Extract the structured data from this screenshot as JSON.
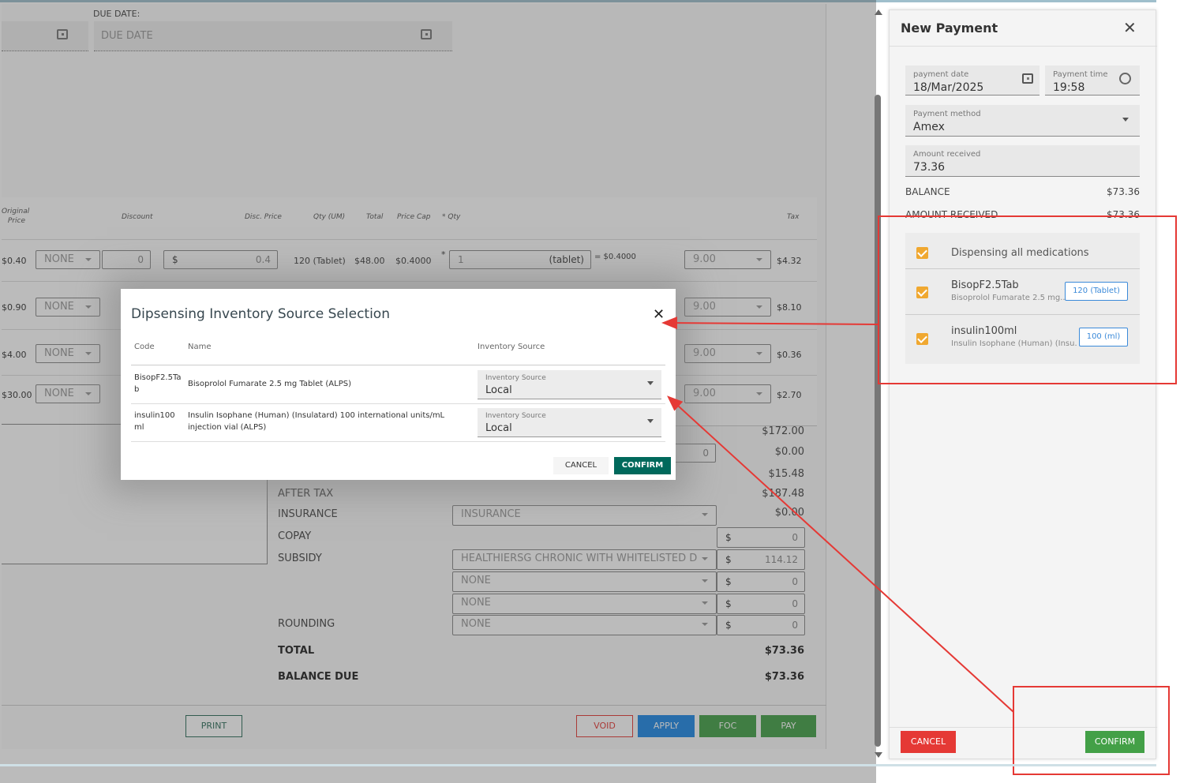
{
  "main": {
    "due_date_label": "DUE DATE:",
    "due_date_placeholder": "DUE DATE",
    "table_headers": {
      "original_price": "Original Price",
      "discount": "Discount",
      "disc_price": "Disc. Price",
      "qty_um": "Qty (UM)",
      "total": "Total",
      "price_cap": "Price Cap",
      "star_qty": "* Qty",
      "tax": "Tax"
    },
    "rows": [
      {
        "price": "$0.40",
        "discount_type": "NONE",
        "discount_value": "0",
        "currency": "$",
        "disc_price": "0.4",
        "qty_um": "120 (Tablet)",
        "total": "$48.00",
        "price_cap": "$0.4000",
        "qty_value": "1",
        "qty_unit": "(tablet)",
        "qty_eq": "= $0.4000",
        "tax_rate": "9.00",
        "tax": "$4.32"
      },
      {
        "price": "$0.90",
        "discount_type": "NONE",
        "tax_rate": "9.00",
        "tax": "$8.10"
      },
      {
        "price": "$4.00",
        "discount_type": "NONE",
        "tax_rate": "9.00",
        "tax": "$0.36"
      },
      {
        "price": "$30.00",
        "discount_type": "NONE",
        "tax_rate": "9.00",
        "tax": "$2.70"
      }
    ],
    "summary_values": {
      "v1": "$172.00",
      "discount_input": "0",
      "v2": "$0.00",
      "v3": "$15.48",
      "after_tax_label": "AFTER TAX",
      "after_tax": "$187.48",
      "insurance_label": "INSURANCE",
      "insurance_select": "INSURANCE",
      "insurance": "$0.00",
      "copay_label": "COPAY",
      "copay_currency": "$",
      "copay": "0",
      "subsidy_label": "SUBSIDY",
      "subsidy_select": "HEALTHIERSG CHRONIC WITH WHITELISTED D",
      "subsidy_currency": "$",
      "subsidy": "114.12",
      "extra1_select": "NONE",
      "extra1_currency": "$",
      "extra1": "0",
      "extra2_select": "NONE",
      "extra2_currency": "$",
      "extra2": "0",
      "rounding_label": "ROUNDING",
      "rounding_select": "NONE",
      "rounding_currency": "$",
      "rounding": "0",
      "total_label": "TOTAL",
      "total": "$73.36",
      "balance_due_label": "BALANCE DUE",
      "balance_due": "$73.36"
    },
    "buttons": {
      "print": "PRINT",
      "void": "VOID",
      "apply": "APPLY",
      "foc": "FOC",
      "pay": "PAY"
    }
  },
  "payment_panel": {
    "title": "New Payment",
    "payment_date_label": "payment date",
    "payment_date": "18/Mar/2025",
    "payment_time_label": "Payment time",
    "payment_time": "19:58",
    "payment_method_label": "Payment method",
    "payment_method": "Amex",
    "amount_received_label": "Amount received",
    "amount_received": "73.36",
    "balance_label": "BALANCE",
    "balance": "$73.36",
    "amount_received_row_label": "AMOUNT RECEIVED",
    "amount_received_row": "$73.36",
    "dispensing_all": "Dispensing all medications",
    "medications": [
      {
        "code": "BisopF2.5Tab",
        "name": "Bisoprolol Fumarate 2.5 mg...",
        "qty": "120 (Tablet)"
      },
      {
        "code": "insulin100ml",
        "name": "Insulin Isophane (Human) (Insu...",
        "qty": "100 (ml)"
      }
    ],
    "cancel": "CANCEL",
    "confirm": "CONFIRM"
  },
  "dialog": {
    "title": "Dipsensing Inventory Source Selection",
    "col_code": "Code",
    "col_name": "Name",
    "col_source": "Inventory Source",
    "rows": [
      {
        "code": "BisopF2.5Tab",
        "name": "Bisoprolol Fumarate 2.5 mg Tablet (ALPS)",
        "source_label": "Inventory Source",
        "source": "Local"
      },
      {
        "code": "insulin100ml",
        "name": "Insulin Isophane (Human) (Insulatard) 100 international units/mL injection vial (ALPS)",
        "source_label": "Inventory Source",
        "source": "Local"
      }
    ],
    "cancel": "CANCEL",
    "confirm": "CONFIRM"
  },
  "colors": {
    "confirm_green": "#00695c",
    "pay_green": "#43a047",
    "apply_blue": "#1e88e5",
    "cancel_red": "#e53935",
    "checkbox_orange": "#f0a830",
    "annotation_red": "#e53935"
  }
}
